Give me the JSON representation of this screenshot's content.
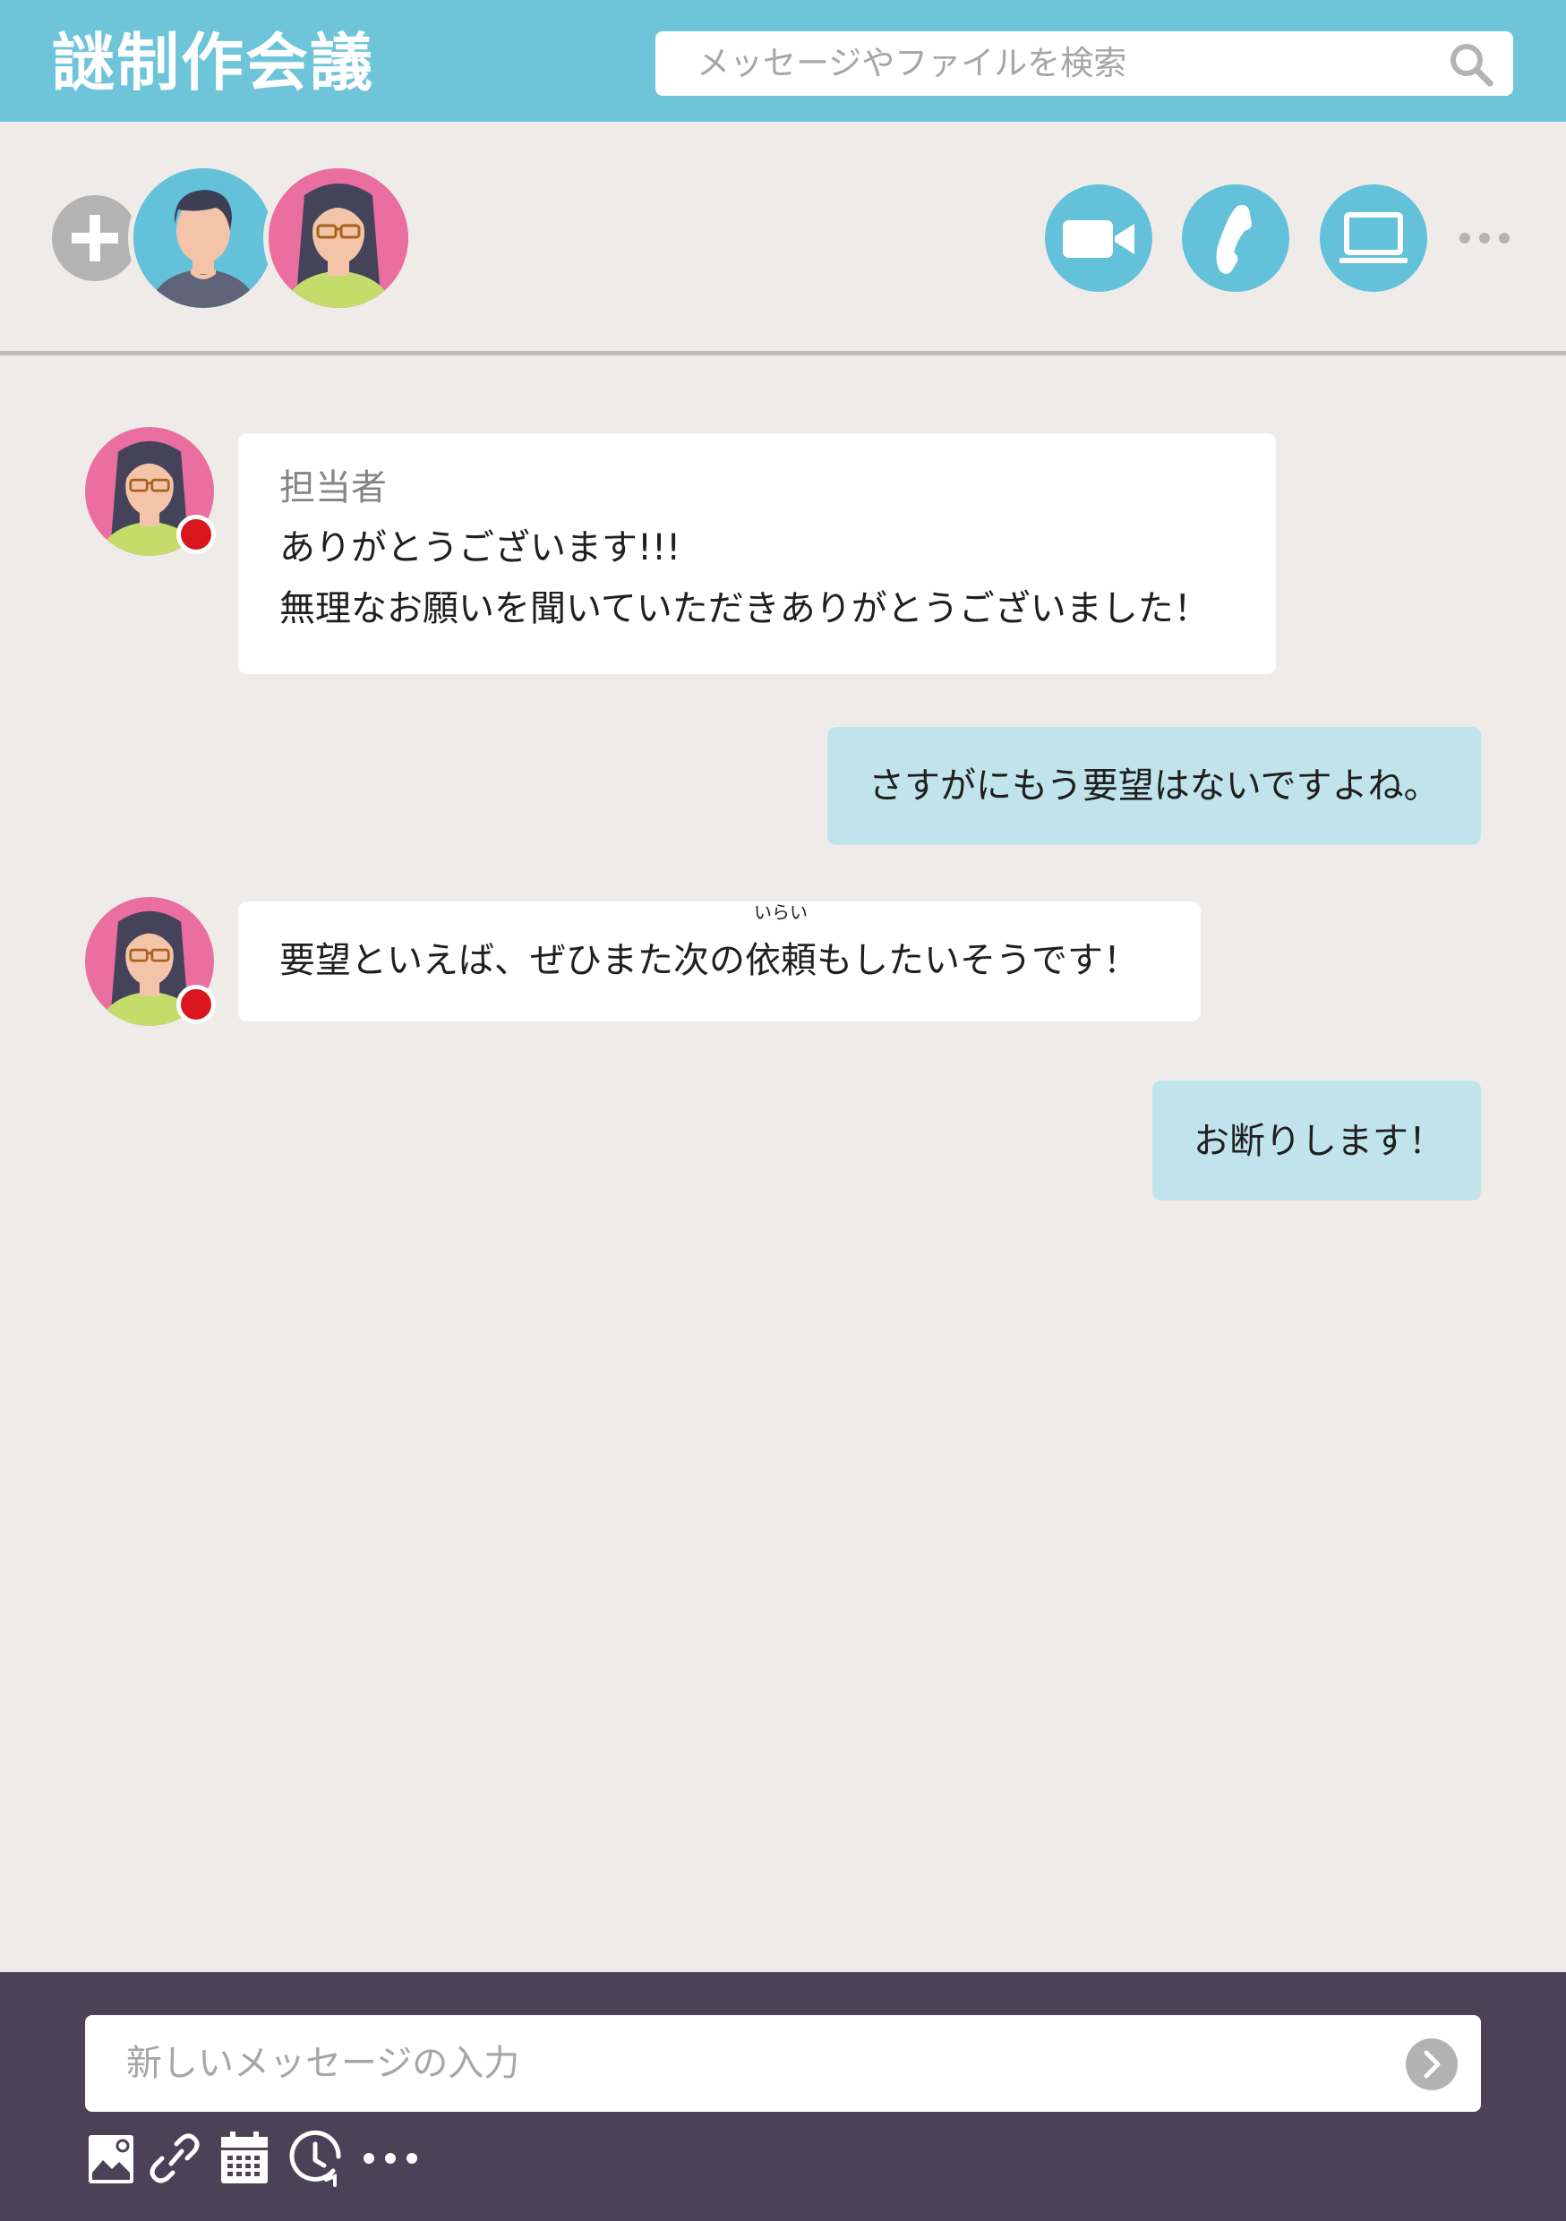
{
  "header": {
    "app_title": "謎制作会議",
    "search_placeholder": "メッセージやファイルを検索",
    "search_icon": "search-icon"
  },
  "toolbar": {
    "add_member_icon": "plus-icon",
    "members": [
      {
        "name": "member-male",
        "avatar_color": "#64c1da"
      },
      {
        "name": "member-female",
        "avatar_color": "#ea6fa0"
      }
    ],
    "actions": [
      "video-call-icon",
      "phone-icon",
      "screen-share-icon",
      "more-icon"
    ],
    "accent_color": "#64c1da"
  },
  "messages": [
    {
      "direction": "in",
      "sender": "担当者",
      "lines": [
        "ありがとうございます!!!",
        "無理なお願いを聞いていただきありがとうございました！"
      ],
      "status_color": "#d9161e"
    },
    {
      "direction": "out",
      "lines": [
        "さすがにもう要望はないですよね。"
      ]
    },
    {
      "direction": "in",
      "text_before": "要望といえば、ぜひまた次の",
      "ruby_base": "依頼",
      "ruby_reading": "いらい",
      "text_after": "もしたいそうです！",
      "status_color": "#d9161e"
    },
    {
      "direction": "out",
      "lines": [
        "お断りします！"
      ]
    }
  ],
  "composer": {
    "placeholder": "新しいメッセージの入力",
    "send_icon": "send-arrow-icon",
    "tools": [
      "image-icon",
      "link-icon",
      "calendar-icon",
      "clock-icon",
      "more-icon"
    ],
    "background": "#4b4257"
  }
}
